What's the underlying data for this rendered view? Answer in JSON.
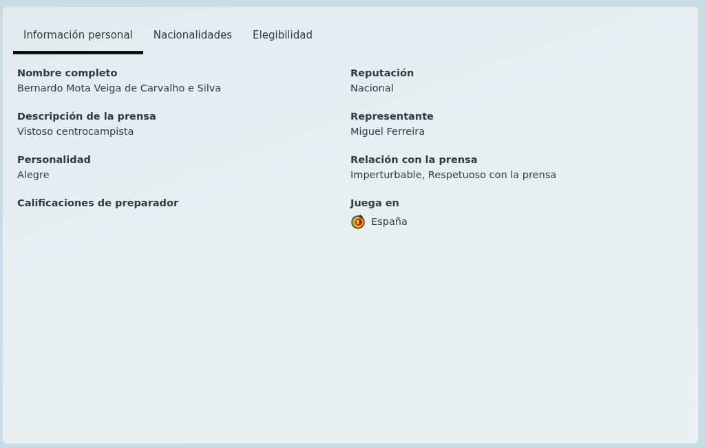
{
  "tabs": [
    {
      "label": "Información personal",
      "selected": true
    },
    {
      "label": "Nacionalidades",
      "selected": false
    },
    {
      "label": "Elegibilidad",
      "selected": false
    }
  ],
  "columns": [
    {
      "fields": [
        {
          "label": "Nombre completo",
          "kind": "text",
          "value": "Bernardo Mota Veiga de Carvalho e Silva"
        },
        {
          "label": "Descripción de la prensa",
          "kind": "text",
          "value": "Vistoso centrocampista"
        },
        {
          "label": "Personalidad",
          "kind": "text",
          "value": "Alegre"
        },
        {
          "label": "Calificaciones de preparador",
          "kind": "empty"
        }
      ]
    },
    {
      "fields": [
        {
          "label": "Reputación",
          "kind": "text",
          "value": "Nacional"
        },
        {
          "label": "Representante",
          "kind": "text",
          "value": "Miguel Ferreira"
        },
        {
          "label": "Relación con la prensa",
          "kind": "text",
          "value": "Imperturbable, Respetuoso con la prensa"
        },
        {
          "label": "Juega en",
          "kind": "club",
          "value": "España"
        }
      ]
    }
  ]
}
